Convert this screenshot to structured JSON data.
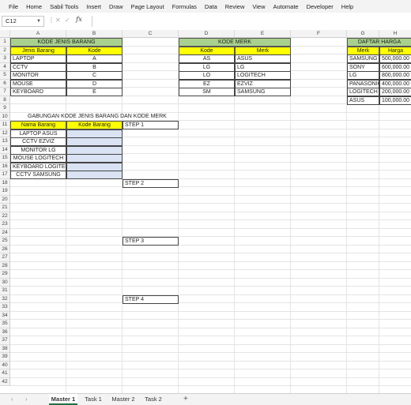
{
  "ribbon": {
    "tabs": [
      "File",
      "Home",
      "Sabil Tools",
      "Insert",
      "Draw",
      "Page Layout",
      "Formulas",
      "Data",
      "Review",
      "View",
      "Automate",
      "Developer",
      "Help"
    ]
  },
  "formula_bar": {
    "name_box": "C12",
    "fx": "fx",
    "formula": ""
  },
  "columns": [
    "A",
    "B",
    "C",
    "D",
    "E",
    "F",
    "G",
    "H"
  ],
  "rows": [
    "1",
    "2",
    "3",
    "4",
    "5",
    "6",
    "7",
    "8",
    "9",
    "10",
    "11",
    "12",
    "13",
    "14",
    "15",
    "16",
    "17",
    "18",
    "19",
    "20",
    "21",
    "22",
    "23",
    "24",
    "25",
    "26",
    "27",
    "28",
    "29",
    "30",
    "31",
    "32",
    "33",
    "34",
    "35",
    "36",
    "37",
    "38",
    "39",
    "40",
    "41",
    "42"
  ],
  "table_jenis": {
    "title": "KODE JENIS BARANG",
    "headers": [
      "Jenis Barang",
      "Kode"
    ],
    "rows": [
      [
        "LAPTOP",
        "A"
      ],
      [
        "CCTV",
        "B"
      ],
      [
        "MONITOR",
        "C"
      ],
      [
        "MOUSE",
        "D"
      ],
      [
        "KEYBOARD",
        "E"
      ]
    ]
  },
  "table_merk": {
    "title": "KODE MERK",
    "headers": [
      "Kode",
      "Merk"
    ],
    "rows": [
      [
        "AS",
        "ASUS"
      ],
      [
        "LG",
        "LG"
      ],
      [
        "LO",
        "LOGITECH"
      ],
      [
        "EZ",
        "EZVIZ"
      ],
      [
        "SM",
        "SAMSUNG"
      ]
    ]
  },
  "table_harga": {
    "title": "DAFTAR HARGA",
    "headers": [
      "Merk",
      "Harga"
    ],
    "rows": [
      [
        "SAMSUNG",
        "500,000.00"
      ],
      [
        "SONY",
        "600,000.00"
      ],
      [
        "LG",
        "800,000.00"
      ],
      [
        "PANASONIC",
        "400,000.00"
      ],
      [
        "LOGITECH",
        "200,000.00"
      ],
      [
        "ASUS",
        "100,000.00"
      ]
    ]
  },
  "gabungan": {
    "title": "GABUNGAN KODE JENIS BARANG DAN KODE MERK",
    "headers": [
      "Nama Barang",
      "Kode Barang"
    ],
    "rows": [
      "LAPTOP ASUS",
      "CCTV EZVIZ",
      "MONITOR LG",
      "MOUSE LOGITECH",
      "KEYBOARD LOGITECH",
      "CCTV SAMSUNG"
    ]
  },
  "steps": [
    "STEP 1",
    "STEP 2",
    "STEP 3",
    "STEP 4"
  ],
  "sheets": {
    "tabs": [
      "Master 1",
      "Task 1",
      "Master 2",
      "Task 2"
    ],
    "active": "Master 1",
    "add": "+"
  }
}
